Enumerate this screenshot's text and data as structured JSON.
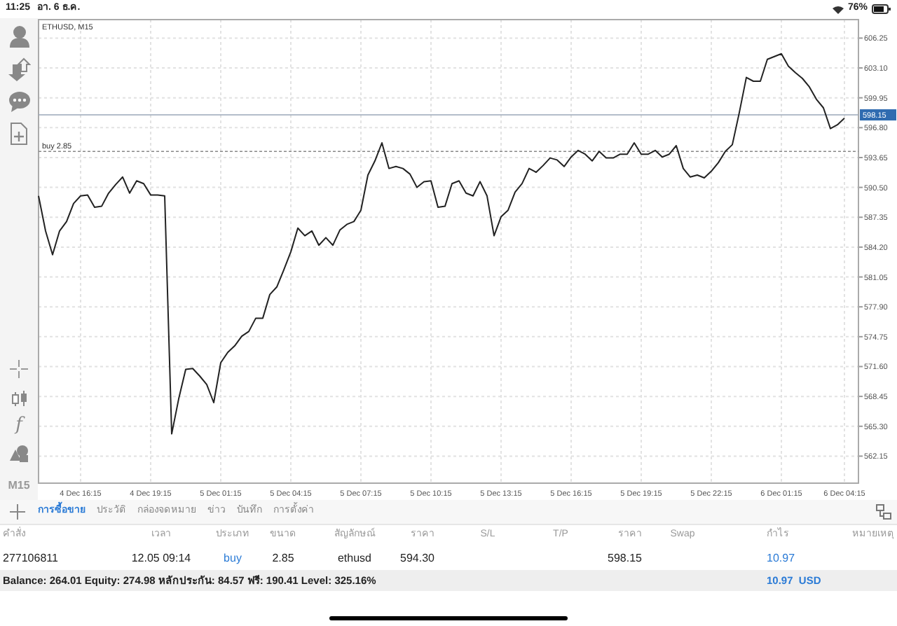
{
  "status_bar": {
    "time": "11:25",
    "date": "อา. 6 ธ.ค.",
    "battery": "76%"
  },
  "left_toolbar": {
    "function_glyph": "f",
    "timeframe": "M15"
  },
  "chart": {
    "title": "ETHUSD, M15",
    "chart_data": {
      "type": "line",
      "categories": [
        null,
        null,
        null,
        null,
        null,
        null,
        "4 Dec 16:15",
        null,
        null,
        null,
        null,
        null,
        null,
        null,
        null,
        null,
        "4 Dec 19:15",
        null,
        null,
        null,
        null,
        null,
        null,
        null,
        null,
        null,
        "5 Dec 01:15",
        null,
        null,
        null,
        null,
        null,
        null,
        null,
        null,
        null,
        "5 Dec 04:15",
        null,
        null,
        null,
        null,
        null,
        null,
        null,
        null,
        null,
        "5 Dec 07:15",
        null,
        null,
        null,
        null,
        null,
        null,
        null,
        null,
        null,
        "5 Dec 10:15",
        null,
        null,
        null,
        null,
        null,
        null,
        null,
        null,
        null,
        "5 Dec 13:15",
        null,
        null,
        null,
        null,
        null,
        null,
        null,
        null,
        null,
        "5 Dec 16:15",
        null,
        null,
        null,
        null,
        null,
        null,
        null,
        null,
        null,
        "5 Dec 19:15",
        null,
        null,
        null,
        null,
        null,
        null,
        null,
        null,
        null,
        "5 Dec 22:15",
        null,
        null,
        null,
        null,
        null,
        null,
        null,
        null,
        null,
        "6 Dec 01:15",
        null,
        null,
        null,
        null,
        null,
        null,
        null,
        null,
        "6 Dec 04:15"
      ],
      "series": [
        {
          "color": "#222222",
          "values": [
            589.6,
            585.9,
            583.4,
            585.9,
            586.9,
            588.8,
            589.6,
            589.7,
            588.4,
            588.5,
            589.9,
            590.8,
            591.6,
            589.9,
            591.2,
            590.9,
            589.7,
            589.7,
            589.6,
            564.5,
            568.2,
            571.3,
            571.4,
            570.6,
            569.7,
            567.8,
            572.0,
            573.1,
            573.8,
            574.8,
            575.3,
            576.7,
            576.7,
            579.2,
            580.0,
            581.8,
            583.7,
            586.2,
            585.4,
            585.9,
            584.4,
            585.2,
            584.4,
            586.0,
            586.6,
            586.9,
            588.1,
            591.8,
            593.3,
            595.2,
            592.5,
            592.7,
            592.5,
            591.9,
            590.5,
            591.1,
            591.2,
            588.4,
            588.5,
            590.9,
            591.2,
            589.9,
            589.6,
            591.1,
            589.6,
            585.4,
            587.4,
            588.1,
            590.0,
            590.9,
            592.5,
            592.1,
            592.8,
            593.6,
            593.4,
            592.7,
            593.7,
            594.4,
            594.0,
            593.3,
            594.3,
            593.6,
            593.6,
            594.0,
            594.0,
            595.2,
            594.0,
            594.0,
            594.4,
            593.7,
            594.0,
            594.9,
            592.5,
            591.6,
            591.8,
            591.5,
            592.2,
            593.1,
            594.3,
            595.0,
            598.4,
            602.1,
            601.7,
            601.7,
            604.0,
            604.3,
            604.6,
            603.3,
            602.6,
            602.0,
            601.1,
            599.8,
            598.9,
            596.7,
            597.1,
            597.8
          ]
        }
      ],
      "ylim": [
        559.3,
        608.2
      ],
      "grid": true,
      "yticks": [
        {
          "value": 606.25,
          "label": "606.25"
        },
        {
          "value": 603.1,
          "label": "603.10"
        },
        {
          "value": 599.95,
          "label": "599.95"
        },
        {
          "value": 596.8,
          "label": "596.80"
        },
        {
          "value": 593.65,
          "label": "593.65"
        },
        {
          "value": 590.5,
          "label": "590.50"
        },
        {
          "value": 587.35,
          "label": "587.35"
        },
        {
          "value": 584.2,
          "label": "584.20"
        },
        {
          "value": 581.05,
          "label": "581.05"
        },
        {
          "value": 577.9,
          "label": "577.90"
        },
        {
          "value": 574.75,
          "label": "574.75"
        },
        {
          "value": 571.6,
          "label": "571.60"
        },
        {
          "value": 568.45,
          "label": "568.45"
        },
        {
          "value": 565.3,
          "label": "565.30"
        },
        {
          "value": 562.15,
          "label": "562.15"
        }
      ],
      "ref_lines": [
        {
          "axis": "y",
          "value": 598.15,
          "label": "598.15",
          "color": "#9aa7b8"
        },
        {
          "axis": "y",
          "value": 594.3,
          "label": "buy 2.85",
          "color": "#888888"
        }
      ]
    }
  },
  "tabs": [
    {
      "label": "การซื้อขาย",
      "selected": true
    },
    {
      "label": "ประวัติ",
      "selected": false
    },
    {
      "label": "กล่องจดหมาย",
      "selected": false
    },
    {
      "label": "ข่าว",
      "selected": false
    },
    {
      "label": "บันทึก",
      "selected": false
    },
    {
      "label": "การตั้งค่า",
      "selected": false
    }
  ],
  "table": {
    "columns": [
      "คำสั่ง",
      "เวลา",
      "ประเภท",
      "ขนาด",
      "สัญลักษณ์",
      "ราคา",
      "S/L",
      "T/P",
      "ราคา",
      "Swap",
      "กำไร",
      "หมายเหตุ"
    ],
    "rows": [
      {
        "order": "277106811",
        "time": "12.05 09:14",
        "type": "buy",
        "volume": "2.85",
        "symbol": "ethusd",
        "open_price": "594.30",
        "price": "598.15",
        "profit": "10.97"
      }
    ]
  },
  "summary": {
    "text": "Balance: 264.01 Equity: 274.98 หลักประกัน: 84.57 ฟรี: 190.41 Level: 325.16%",
    "profit": "10.97",
    "currency": "USD"
  }
}
